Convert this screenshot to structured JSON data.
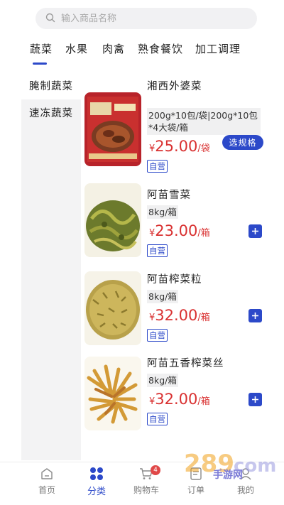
{
  "search": {
    "placeholder": "输入商品名称"
  },
  "tabs": [
    {
      "label": "蔬菜"
    },
    {
      "label": "水果"
    },
    {
      "label": "肉禽"
    },
    {
      "label": "熟食餐饮"
    },
    {
      "label": "加工调理"
    }
  ],
  "sidebar": {
    "items": [
      {
        "label": "腌制蔬菜"
      },
      {
        "label": "速冻蔬菜"
      }
    ]
  },
  "products": [
    {
      "name": "湘西外婆菜",
      "spec": "200g*10包/袋|200g*10包*4大袋/箱",
      "currency": "¥",
      "price": "25.00",
      "unit": "/袋",
      "badge": "自营",
      "action": "选规格"
    },
    {
      "name": "阿苗雪菜",
      "spec": "8kg/箱",
      "currency": "¥",
      "price": "23.00",
      "unit": "/箱",
      "badge": "自营"
    },
    {
      "name": "阿苗榨菜粒",
      "spec": "8kg/箱",
      "currency": "¥",
      "price": "32.00",
      "unit": "/箱",
      "badge": "自营"
    },
    {
      "name": "阿苗五香榨菜丝",
      "spec": "8kg/箱",
      "currency": "¥",
      "price": "32.00",
      "unit": "/箱",
      "badge": "自营"
    }
  ],
  "bottom_nav": [
    {
      "label": "首页",
      "icon": "home-icon"
    },
    {
      "label": "分类",
      "icon": "category-icon"
    },
    {
      "label": "购物车",
      "icon": "cart-icon",
      "badge": "4"
    },
    {
      "label": "订单",
      "icon": "order-icon"
    },
    {
      "label": "我的",
      "icon": "profile-icon"
    }
  ],
  "watermark": {
    "text": "手游网"
  },
  "colors": {
    "accent": "#2c49c9",
    "price": "#d93131",
    "sidebar_bg": "#f3f3f4"
  }
}
